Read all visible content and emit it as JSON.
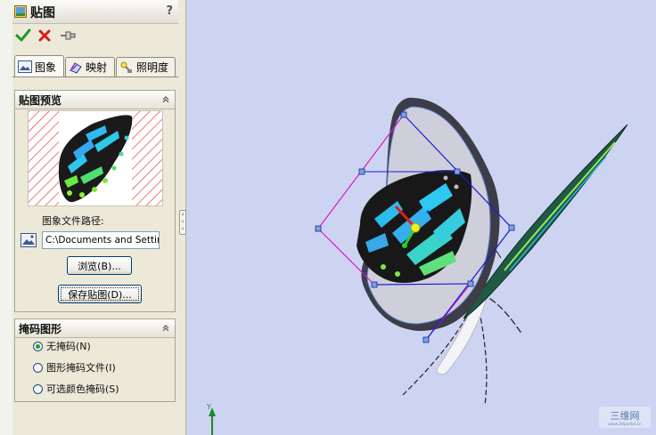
{
  "property_manager": {
    "title": "贴图",
    "help": "?",
    "tabs": [
      {
        "label": "图象",
        "icon": "image-icon"
      },
      {
        "label": "映射",
        "icon": "mapping-icon"
      },
      {
        "label": "照明度",
        "icon": "lighting-icon"
      }
    ],
    "decal_preview": {
      "heading": "贴图预览",
      "image_path_label": "图象文件路径:",
      "image_path_value": "C:\\Documents and Settings",
      "browse_label": "浏览(B)...",
      "save_label": "保存贴图(D)..."
    },
    "mask": {
      "heading": "掩码图形",
      "options": [
        "无掩码(N)",
        "图形掩码文件(I)",
        "可选颜色掩码(S)"
      ],
      "selected": "无掩码(N)"
    }
  },
  "watermark": {
    "text": "三维网",
    "sub": "www.3dportal.cn"
  },
  "colors": {
    "viewport_bg": "#cdd4f2",
    "handle_blue": "#1a1ad8",
    "handle_magenta": "#e018c8",
    "panel_bg": "#ece9d8"
  }
}
